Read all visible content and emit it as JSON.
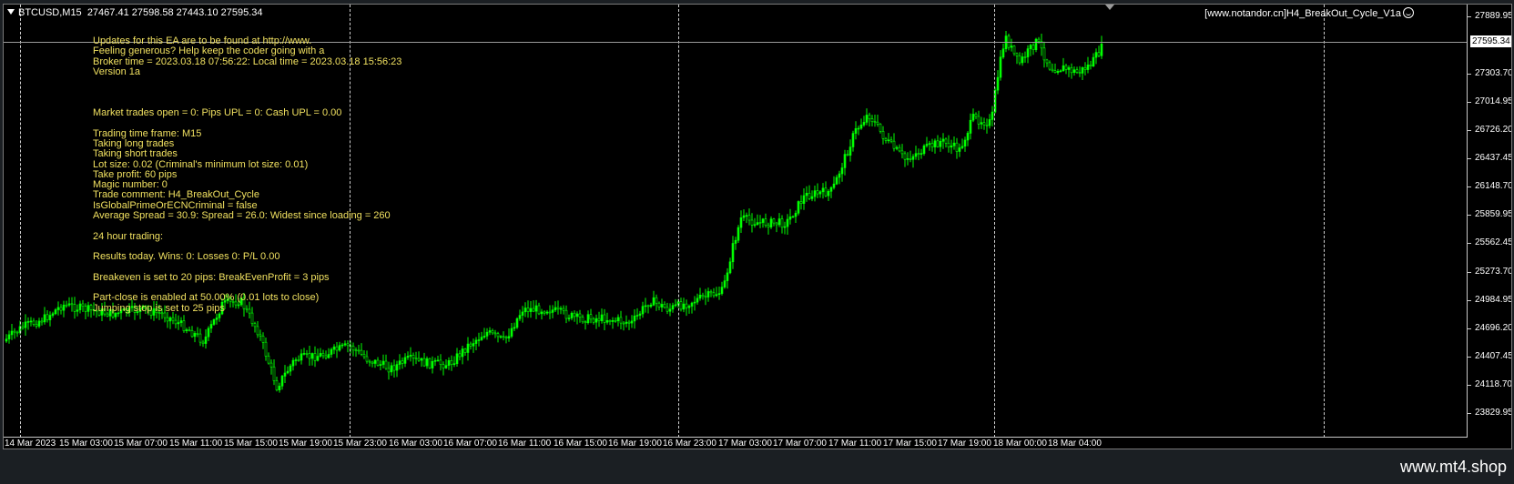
{
  "chart_header": {
    "symbol": "BTCUSD,M15",
    "ohlc": "27467.41 27598.58 27443.10 27595.34"
  },
  "ea_name": "[www.notandor.cn]H4_BreakOut_Cycle_V1a",
  "info_lines": [
    "Updates for this EA are to be found at http://www.",
    "Feeling generous? Help keep the coder going with a",
    "Broker time = 2023.03.18 07:56:22: Local time = 2023.03.18 15:56:23",
    "Version 1a",
    "",
    "",
    "",
    "Market trades open = 0: Pips UPL = 0: Cash UPL = 0.00",
    "",
    "Trading time frame: M15",
    "Taking long trades",
    "Taking short trades",
    "Lot size: 0.02 (Criminal's minimum lot size: 0.01)",
    "Take profit: 60 pips",
    "Magic number: 0",
    "Trade comment: H4_BreakOut_Cycle",
    "IsGlobalPrimeOrECNCriminal = false",
    "Average Spread = 30.9: Spread = 26.0: Widest since loading = 260",
    "",
    "24 hour trading:",
    "",
    "Results today. Wins: 0: Losses 0: P/L 0.00",
    "",
    "Breakeven is set to 20 pips: BreakEvenProfit = 3 pips",
    "",
    "Part-close is enabled at 50.00% (0.01 lots to close)",
    "Jumping stop is set to 25 pips"
  ],
  "current_price": "27595.34",
  "price_labels": [
    "27889.95",
    "27595.34",
    "27303.70",
    "27014.95",
    "26726.20",
    "26437.45",
    "26148.70",
    "25859.95",
    "25562.45",
    "25273.70",
    "24984.95",
    "24696.20",
    "24407.45",
    "24118.70",
    "23829.95"
  ],
  "time_labels": [
    "14 Mar 2023",
    "15 Mar 03:00",
    "15 Mar 07:00",
    "15 Mar 11:00",
    "15 Mar 15:00",
    "15 Mar 19:00",
    "15 Mar 23:00",
    "16 Mar 03:00",
    "16 Mar 07:00",
    "16 Mar 11:00",
    "16 Mar 15:00",
    "16 Mar 19:00",
    "16 Mar 23:00",
    "17 Mar 03:00",
    "17 Mar 07:00",
    "17 Mar 11:00",
    "17 Mar 15:00",
    "17 Mar 19:00",
    "18 Mar 00:00",
    "18 Mar 04:00"
  ],
  "colors": {
    "candle": "#00ff00",
    "info_text": "#f0e060",
    "background": "#000000"
  },
  "watermark": "www.mt4.shop"
}
